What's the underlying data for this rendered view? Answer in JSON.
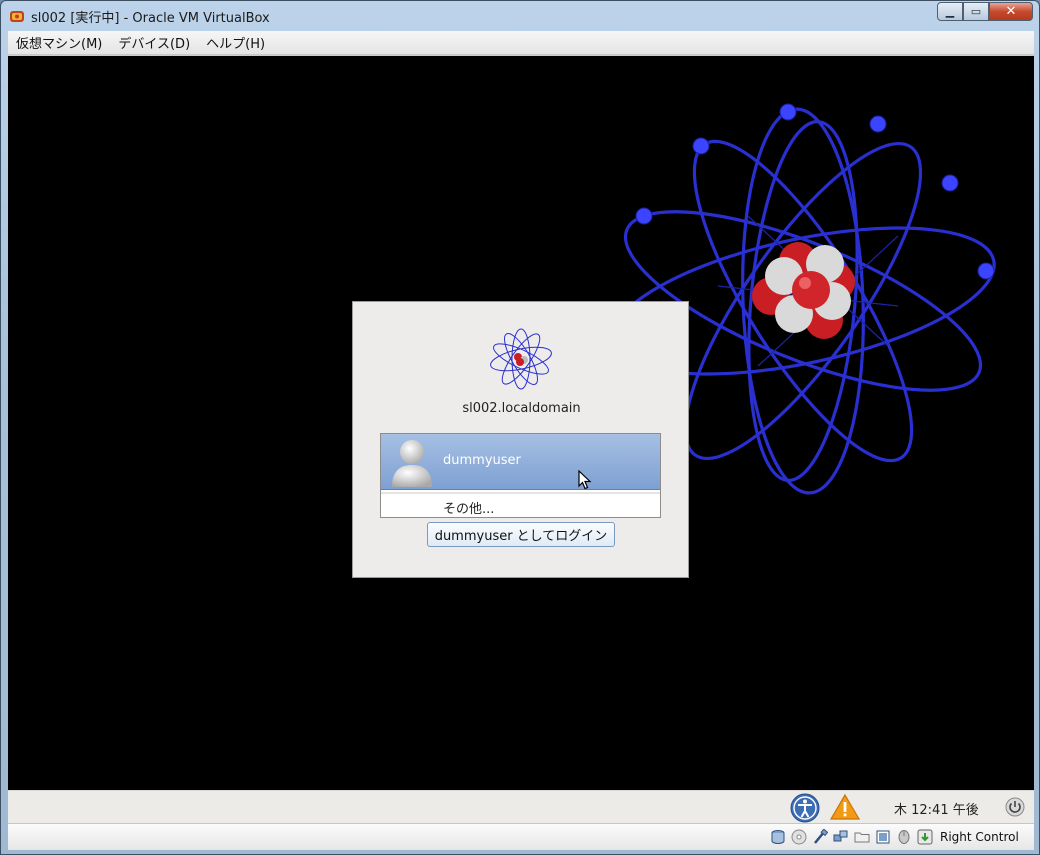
{
  "window": {
    "title": "sl002 [実行中] - Oracle VM VirtualBox",
    "minimize": "▁",
    "maximize": "▭",
    "close": "✕"
  },
  "menu": {
    "items": [
      {
        "label": "仮想マシン(M)"
      },
      {
        "label": "デバイス(D)"
      },
      {
        "label": "ヘルプ(H)"
      }
    ]
  },
  "login": {
    "hostname": "sl002.localdomain",
    "users": [
      {
        "name": "dummyuser",
        "selected": true
      }
    ],
    "other_label": "その他...",
    "login_button": "dummyuser としてログイン"
  },
  "guest_panel": {
    "clock": "木 12:41 午後",
    "icons": [
      "accessibility-icon",
      "warning-icon",
      "power-icon"
    ]
  },
  "statusbar": {
    "icons": [
      "hard-disk-icon",
      "optical-drive-icon",
      "usb-icon",
      "network-icon",
      "shared-folders-icon",
      "video-capture-icon",
      "mouse-integration-icon",
      "host-key-icon"
    ],
    "host_key": "Right Control"
  },
  "colors": {
    "selection": "#7ea0d2",
    "orbit": "#2a31d6",
    "nucleus_red": "#c81e24"
  }
}
